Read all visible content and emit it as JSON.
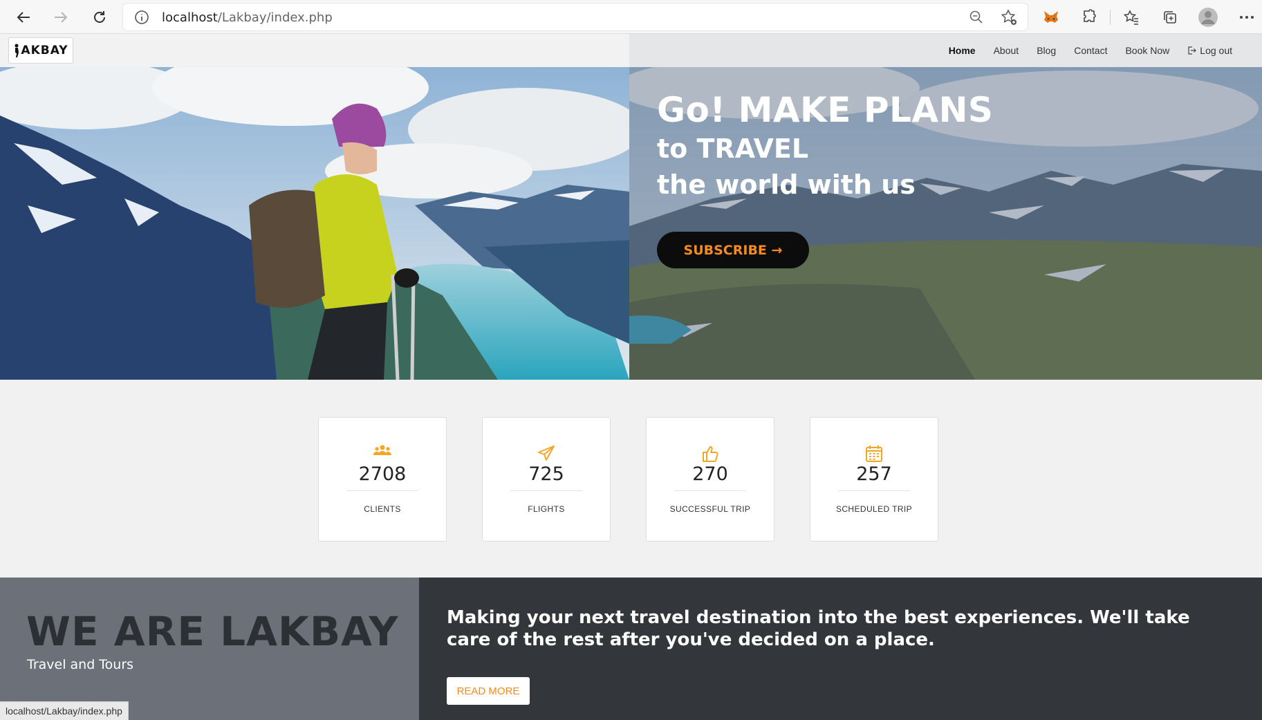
{
  "browser": {
    "url_host": "localhost",
    "url_path": "/Lakbay/index.php",
    "status_url": "localhost/Lakbay/index.php"
  },
  "navbar": {
    "logo_text": "AKBAY",
    "menu": [
      {
        "label": "Home"
      },
      {
        "label": "About"
      },
      {
        "label": "Blog"
      },
      {
        "label": "Contact"
      },
      {
        "label": "Book Now"
      },
      {
        "label": "Log out"
      }
    ]
  },
  "hero": {
    "headline": "Go! MAKE PLANS",
    "line2": "to TRAVEL",
    "line3": "the world with us",
    "subscribe_label": "SUBSCRIBE →"
  },
  "stats": [
    {
      "icon": "users-icon",
      "value": "2708",
      "label": "CLIENTS"
    },
    {
      "icon": "paper-plane-icon",
      "value": "725",
      "label": "FLIGHTS"
    },
    {
      "icon": "thumbs-up-icon",
      "value": "270",
      "label": "SUCCESSFUL TRIP"
    },
    {
      "icon": "calendar-icon",
      "value": "257",
      "label": "SCHEDULED TRIP"
    }
  ],
  "about": {
    "title": "WE ARE LAKBAY",
    "subtitle": "Travel and Tours",
    "text": "Making your next travel destination into the best experiences. We'll take care of the rest after you've decided on a place.",
    "read_more_label": "READ MORE"
  },
  "colors": {
    "accent": "#f58a1f",
    "icon": "#f5a623",
    "dark": "#33363b"
  }
}
